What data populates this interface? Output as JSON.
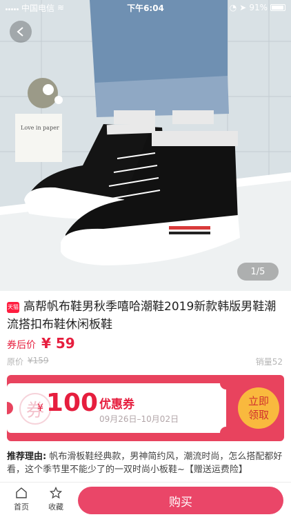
{
  "status_bar": {
    "carrier": "中国电信",
    "time": "下午6:04",
    "battery": "91%"
  },
  "hero": {
    "pager": "1/5",
    "back_icon": "back-arrow-icon"
  },
  "product": {
    "badge": "天猫",
    "title": "高帮帆布鞋男秋季嘻哈潮鞋2019新款韩版男鞋潮流搭扣布鞋休闲板鞋",
    "price_label": "券后价",
    "price": "¥ 59",
    "original_label": "原价",
    "original_price": "¥159",
    "sales": "销量52"
  },
  "coupon": {
    "yen": "¥",
    "amount": "100",
    "label": "优惠券",
    "date_range": "09月26日–10月02日",
    "claim_line1": "立即",
    "claim_line2": "领取",
    "seal_char": "券"
  },
  "recommendation": {
    "label": "推荐理由:",
    "text": "帆布滑板鞋经典款，男神简约风，潮流时尚，怎么搭配都好看，这个季节里不能少了的一双时尚小板鞋~【赠送运费险】"
  },
  "bottom_bar": {
    "home_label": "首页",
    "favorite_label": "收藏",
    "buy_label": "购买"
  },
  "colors": {
    "accent": "#e61e3e",
    "coupon_bg": "#e8435e",
    "claim_bg": "#f9b93e",
    "buy_bg": "#ea4668"
  }
}
